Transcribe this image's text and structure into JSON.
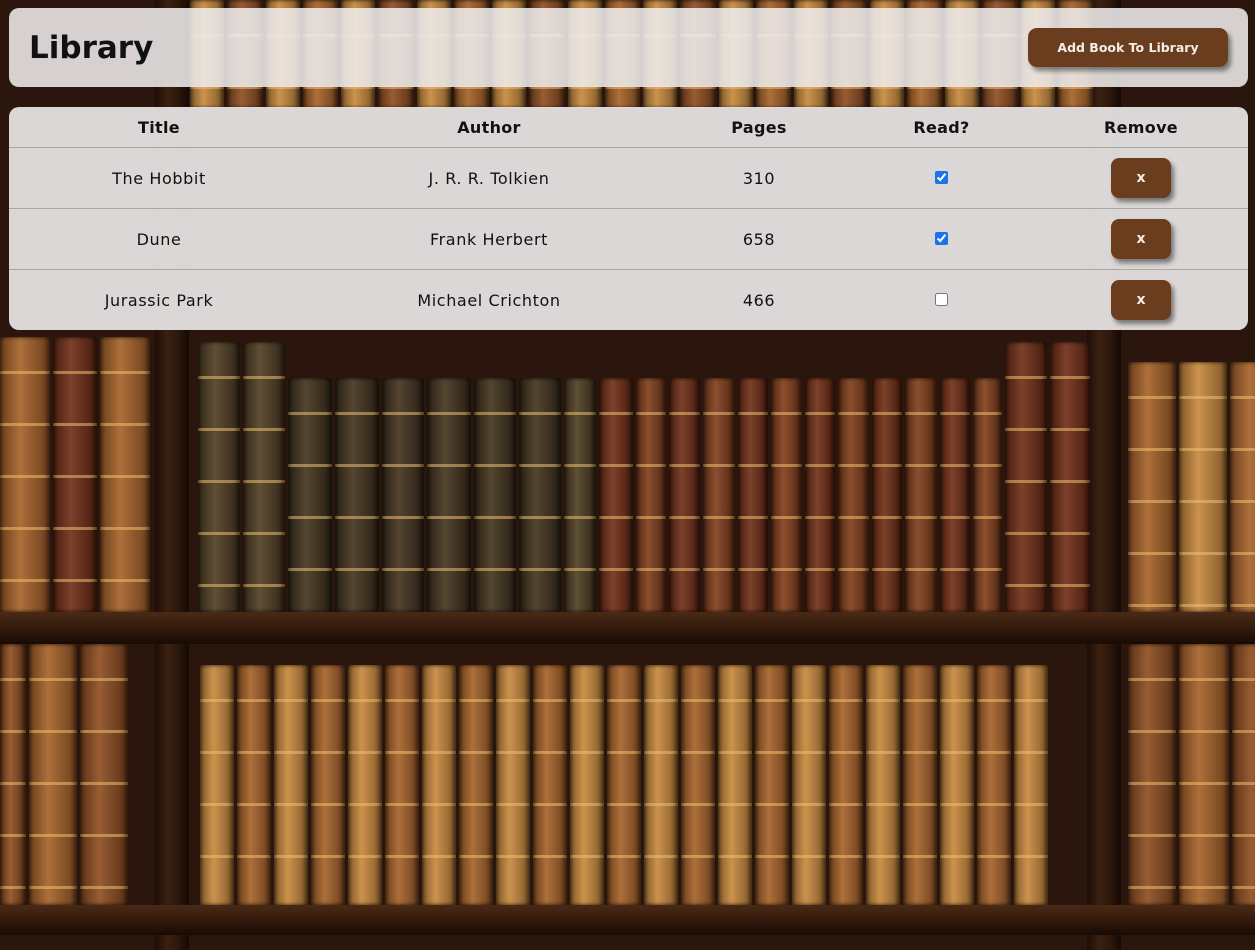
{
  "header": {
    "title": "Library",
    "add_button_label": "Add Book To Library"
  },
  "table": {
    "columns": [
      "Title",
      "Author",
      "Pages",
      "Read?",
      "Remove"
    ],
    "rows": [
      {
        "title": "The Hobbit",
        "author": "J. R. R. Tolkien",
        "pages": "310",
        "read": true,
        "remove_label": "x"
      },
      {
        "title": "Dune",
        "author": "Frank Herbert",
        "pages": "658",
        "read": true,
        "remove_label": "x"
      },
      {
        "title": "Jurassic Park",
        "author": "Michael Crichton",
        "pages": "466",
        "read": false,
        "remove_label": "x"
      }
    ]
  },
  "colors": {
    "button": "#6b3d1f",
    "panel": "#eeecec",
    "checkbox_accent": "#1a73e8"
  }
}
